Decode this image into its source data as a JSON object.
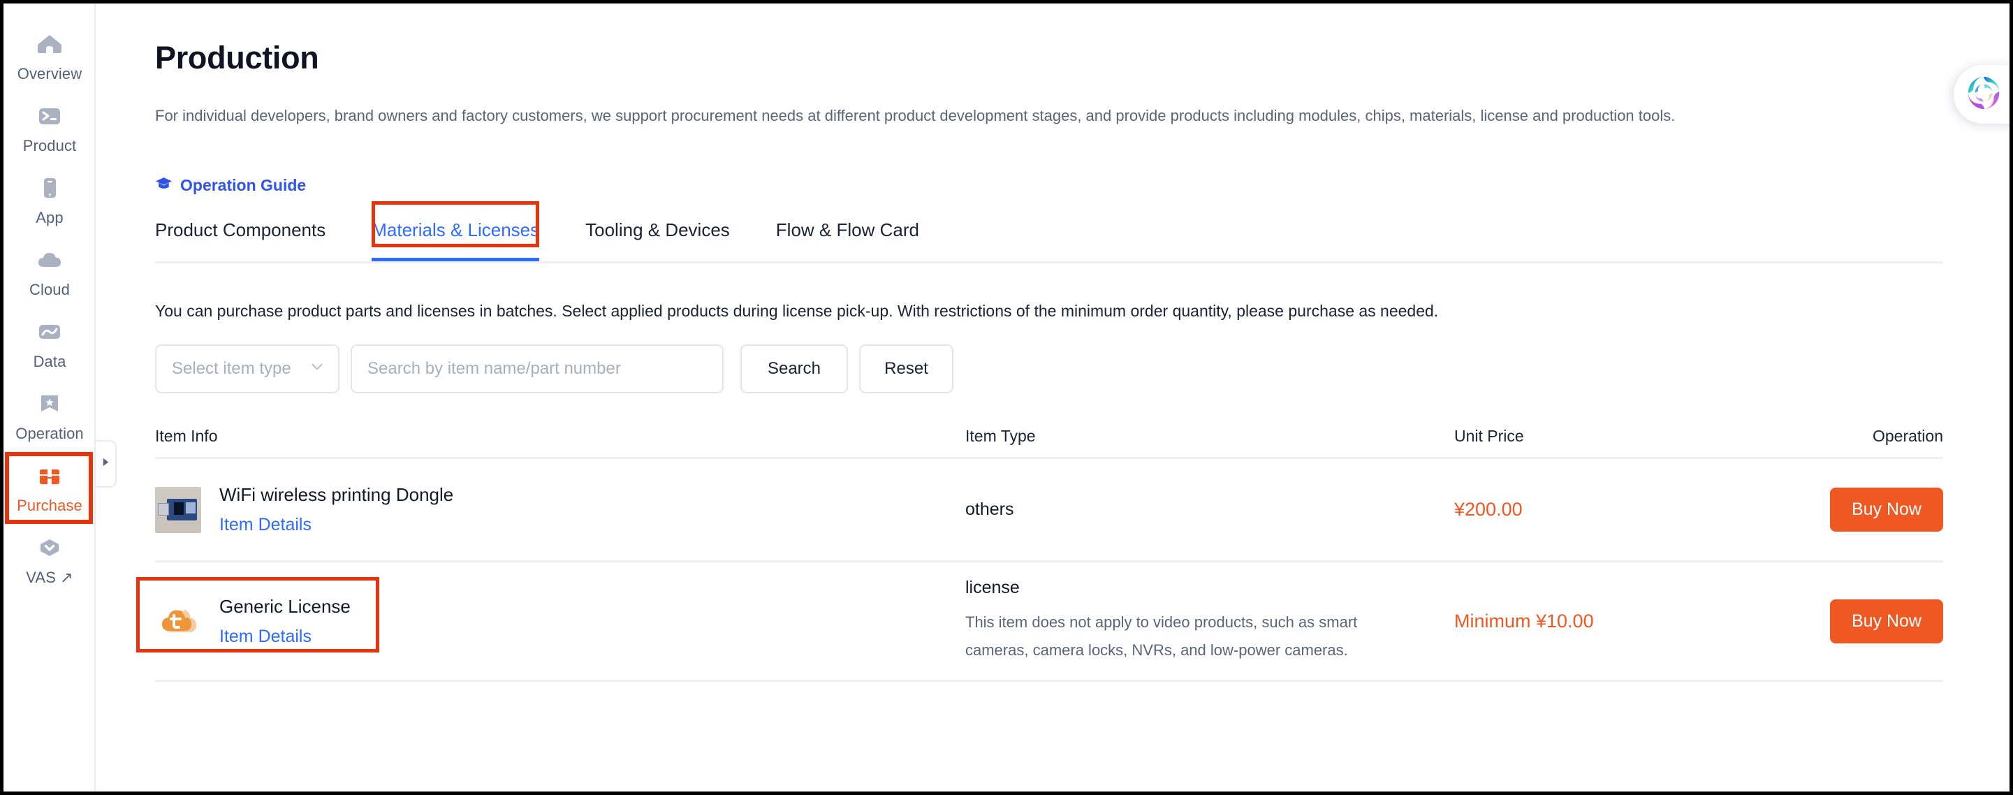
{
  "sidebar": {
    "items": [
      {
        "label": "Overview",
        "icon": "home-icon",
        "active": false
      },
      {
        "label": "Product",
        "icon": "terminal-icon",
        "active": false
      },
      {
        "label": "App",
        "icon": "phone-icon",
        "active": false
      },
      {
        "label": "Cloud",
        "icon": "cloud-icon",
        "active": false
      },
      {
        "label": "Data",
        "icon": "chart-line-icon",
        "active": false
      },
      {
        "label": "Operation",
        "icon": "bookmark-star-icon",
        "active": false
      },
      {
        "label": "Purchase",
        "icon": "toolbox-icon",
        "active": true
      },
      {
        "label": "VAS ↗",
        "icon": "hexagon-chevron-icon",
        "active": false
      }
    ],
    "collapse_icon": "triangle-right-icon"
  },
  "header": {
    "title": "Production",
    "description": "For individual developers, brand owners and factory customers, we support procurement needs at different product development stages, and provide products including modules, chips, materials, license and production tools.",
    "guide_link": "Operation Guide",
    "guide_icon": "graduation-cap-icon"
  },
  "tabs": [
    {
      "label": "Product Components",
      "active": false
    },
    {
      "label": "Materials & Licenses",
      "active": true
    },
    {
      "label": "Tooling & Devices",
      "active": false
    },
    {
      "label": "Flow & Flow Card",
      "active": false
    }
  ],
  "list_note": "You can purchase product parts and licenses in batches. Select applied products during license pick-up. With restrictions of the minimum order quantity, please purchase as needed.",
  "filters": {
    "type_select_placeholder": "Select item type",
    "type_select_icon": "chevron-down-icon",
    "search_placeholder": "Search by item name/part number",
    "search_value": "",
    "search_button": "Search",
    "reset_button": "Reset"
  },
  "table": {
    "columns": {
      "item_info": "Item Info",
      "item_type": "Item Type",
      "unit_price": "Unit Price",
      "operation": "Operation"
    },
    "rows": [
      {
        "name": "WiFi wireless printing Dongle",
        "details_link": "Item Details",
        "thumb": "usb-dongle-photo",
        "type": "others",
        "type_note": "",
        "price": "¥200.00",
        "action": "Buy Now",
        "highlighted": false
      },
      {
        "name": "Generic License",
        "details_link": "Item Details",
        "thumb": "tuya-cloud-icon",
        "type": "license",
        "type_note": "This item does not apply to video products, such as smart cameras, camera locks, NVRs, and low-power cameras.",
        "price": "Minimum ¥10.00",
        "action": "Buy Now",
        "highlighted": true
      }
    ]
  },
  "assistant": {
    "icon": "ai-spiral-icon"
  },
  "colors": {
    "accent_orange": "#ef5822",
    "link_blue": "#2f6bff",
    "guide_blue": "#2f54eb",
    "annotation_red": "#e8340c",
    "text_dark": "#15192a",
    "text_muted": "#5a6478",
    "border_light": "#eef0f4"
  }
}
